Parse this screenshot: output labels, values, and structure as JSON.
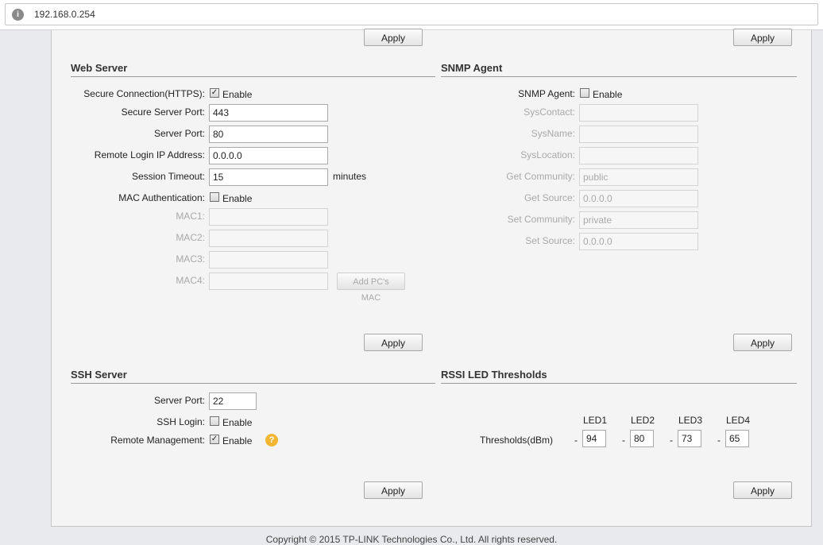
{
  "browser": {
    "url": "192.168.0.254",
    "site_icon": "info-icon"
  },
  "buttons": {
    "apply": "Apply",
    "add_pc_mac": "Add PC's MAC"
  },
  "web_server": {
    "title": "Web Server",
    "https_label": "Secure Connection(HTTPS):",
    "https_checked": true,
    "enable": "Enable",
    "secure_port_label": "Secure Server Port:",
    "secure_port": "443",
    "server_port_label": "Server Port:",
    "server_port": "80",
    "remote_ip_label": "Remote Login IP Address:",
    "remote_ip": "0.0.0.0",
    "timeout_label": "Session Timeout:",
    "timeout": "15",
    "timeout_unit": "minutes",
    "mac_auth_label": "MAC Authentication:",
    "mac_auth_checked": false,
    "mac1_label": "MAC1:",
    "mac2_label": "MAC2:",
    "mac3_label": "MAC3:",
    "mac4_label": "MAC4:"
  },
  "snmp": {
    "title": "SNMP Agent",
    "agent_label": "SNMP Agent:",
    "agent_checked": false,
    "enable": "Enable",
    "syscontact_label": "SysContact:",
    "sysname_label": "SysName:",
    "syslocation_label": "SysLocation:",
    "get_community_label": "Get Community:",
    "get_community": "public",
    "get_source_label": "Get Source:",
    "get_source": "0.0.0.0",
    "set_community_label": "Set Community:",
    "set_community": "private",
    "set_source_label": "Set Source:",
    "set_source": "0.0.0.0"
  },
  "ssh": {
    "title": "SSH Server",
    "port_label": "Server Port:",
    "port": "22",
    "login_label": "SSH Login:",
    "login_checked": false,
    "remote_label": "Remote Management:",
    "remote_checked": true,
    "enable": "Enable",
    "help_icon": "question-icon"
  },
  "rssi": {
    "title": "RSSI LED Thresholds",
    "thresholds_label": "Thresholds(dBm)",
    "minus": "-",
    "leds": [
      {
        "label": "LED1",
        "value": "94"
      },
      {
        "label": "LED2",
        "value": "80"
      },
      {
        "label": "LED3",
        "value": "73"
      },
      {
        "label": "LED4",
        "value": "65"
      }
    ]
  },
  "footer": {
    "copyright": "Copyright © 2015 TP-LINK Technologies Co., Ltd. All rights reserved."
  }
}
